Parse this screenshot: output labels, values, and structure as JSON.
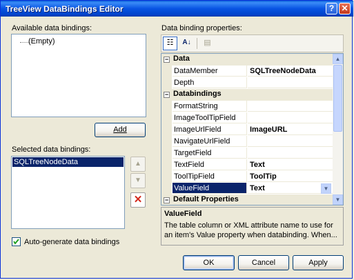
{
  "window": {
    "title": "TreeView DataBindings Editor"
  },
  "left": {
    "available_label": "Available data bindings:",
    "available_items": [
      "(Empty)"
    ],
    "add_label": "Add",
    "selected_label": "Selected data bindings:",
    "selected_items": [
      "SQLTreeNodeData"
    ],
    "autogen_label": "Auto-generate data bindings",
    "autogen_checked": true
  },
  "right": {
    "props_label": "Data binding properties:",
    "categories": [
      {
        "name": "Data",
        "rows": [
          {
            "name": "DataMember",
            "value": "SQLTreeNodeData"
          },
          {
            "name": "Depth",
            "value": ""
          }
        ]
      },
      {
        "name": "Databindings",
        "rows": [
          {
            "name": "FormatString",
            "value": ""
          },
          {
            "name": "ImageToolTipField",
            "value": ""
          },
          {
            "name": "ImageUrlField",
            "value": "ImageURL"
          },
          {
            "name": "NavigateUrlField",
            "value": ""
          },
          {
            "name": "TargetField",
            "value": ""
          },
          {
            "name": "TextField",
            "value": "Text"
          },
          {
            "name": "ToolTipField",
            "value": "ToolTip"
          },
          {
            "name": "ValueField",
            "value": "Text"
          }
        ]
      },
      {
        "name": "Default Properties",
        "rows": []
      }
    ],
    "selected_property": "ValueField",
    "help_title": "ValueField",
    "help_text": "The table column or XML attribute name to use for an item's Value property when databinding. When..."
  },
  "footer": {
    "ok": "OK",
    "cancel": "Cancel",
    "apply": "Apply"
  },
  "colors": {
    "title_bar": "#0054e3",
    "selection": "#0a246a",
    "window_bg": "#ece9d8",
    "grid_line": "#ece9d8"
  },
  "icons": [
    "help-icon",
    "close-icon",
    "categorized-icon",
    "alphabetical-icon",
    "property-pages-icon",
    "move-up-icon",
    "move-down-icon",
    "delete-icon"
  ]
}
